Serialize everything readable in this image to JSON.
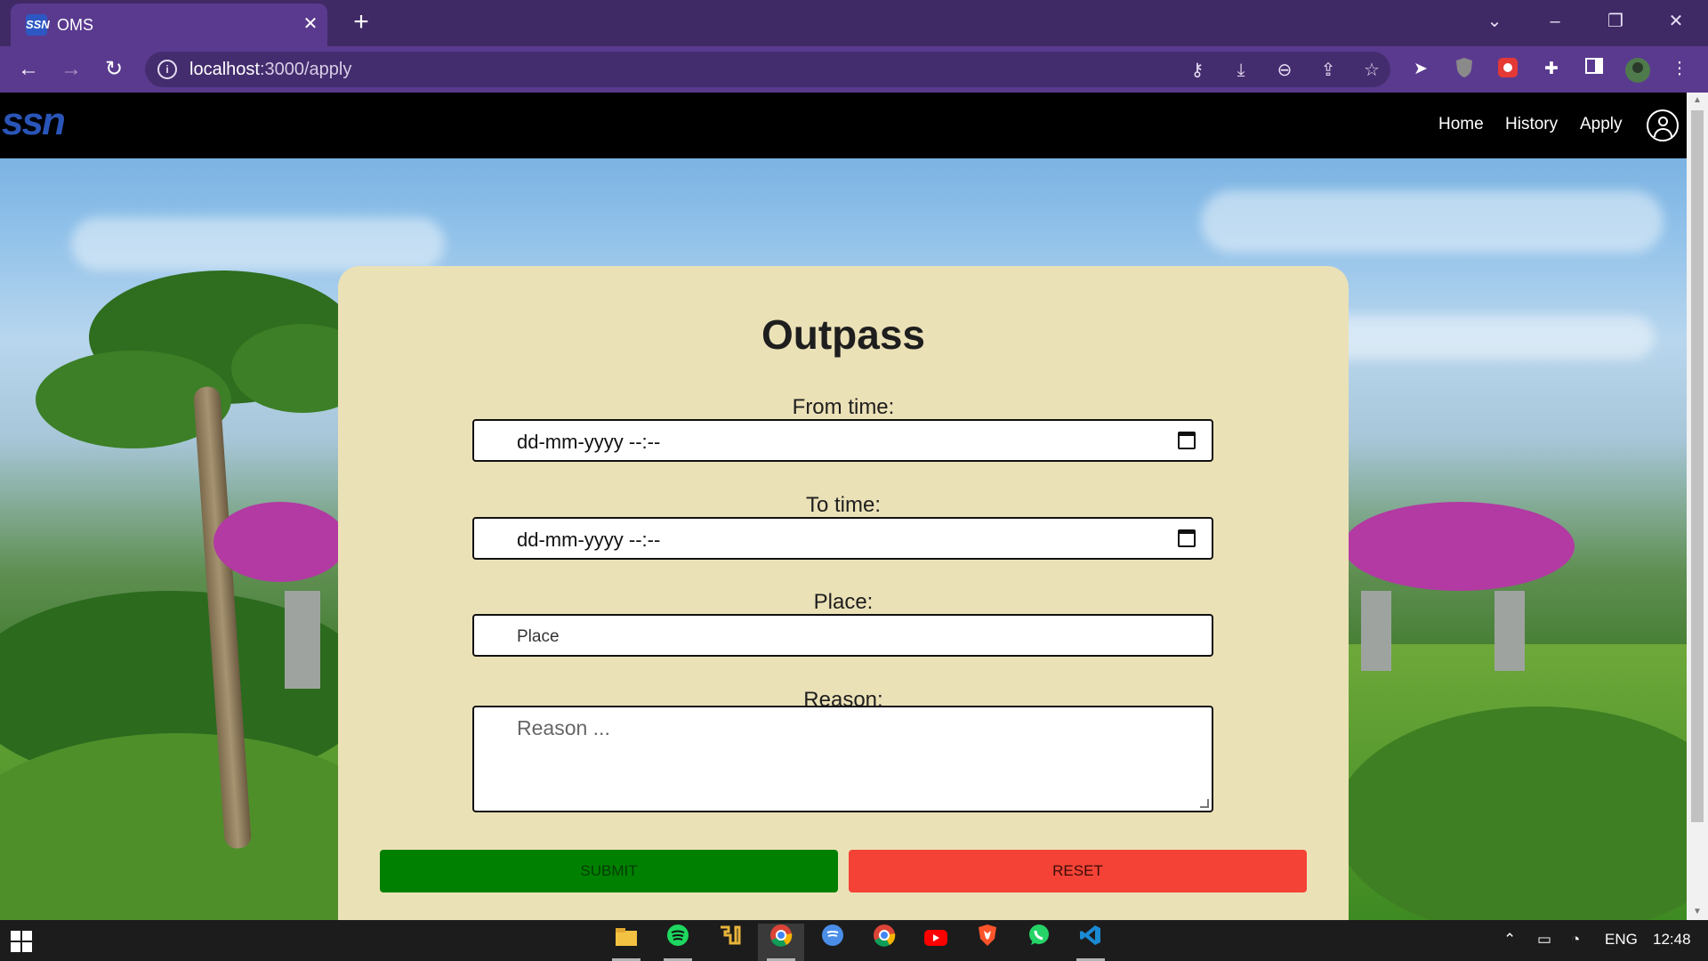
{
  "browser": {
    "tab_title": "OMS",
    "tab_favicon": "SSN",
    "close_glyph": "✕",
    "new_tab_glyph": "+",
    "url_host": "localhost",
    "url_path": ":3000/apply",
    "window_controls": {
      "minimize": "–",
      "restore": "❐",
      "close": "✕",
      "tab_search": "⌄"
    },
    "nav": {
      "back": "←",
      "forward": "→",
      "reload": "↻"
    },
    "omnibox_icons": [
      "key-icon",
      "install-icon",
      "zoom-out-icon",
      "share-icon",
      "bookmark-star-icon"
    ],
    "extensions": [
      "cursor-extension-icon",
      "ublock-extension-icon",
      "red-extension-icon",
      "puzzle-extensions-icon",
      "side-panel-icon",
      "profile-avatar-icon",
      "kebab-menu-icon"
    ]
  },
  "site": {
    "logo_text": "ssn",
    "nav_links": {
      "home": "Home",
      "history": "History",
      "apply": "Apply"
    }
  },
  "form": {
    "title": "Outpass",
    "from_label": "From time:",
    "from_value": "dd-mm-yyyy --:--",
    "to_label": "To time:",
    "to_value": "dd-mm-yyyy --:--",
    "place_label": "Place:",
    "place_placeholder": "Place",
    "reason_label": "Reason:",
    "reason_placeholder": "Reason ...",
    "submit_label": "SUBMIT",
    "reset_label": "RESET"
  },
  "taskbar": {
    "apps": [
      "file-explorer-icon",
      "spotify-icon",
      "app-icon",
      "chrome-icon",
      "spotify-web-icon",
      "chrome-profile-icon",
      "youtube-icon",
      "brave-icon",
      "whatsapp-icon",
      "vscode-icon"
    ],
    "language": "ENG",
    "time": "12:48"
  },
  "colors": {
    "browser_frame": "#3f2a66",
    "browser_toolbar": "#5a3a8f",
    "card_bg": "#ebe1b7",
    "submit_bg": "#008000",
    "reset_bg": "#f44336",
    "nav_bg": "#000000"
  }
}
